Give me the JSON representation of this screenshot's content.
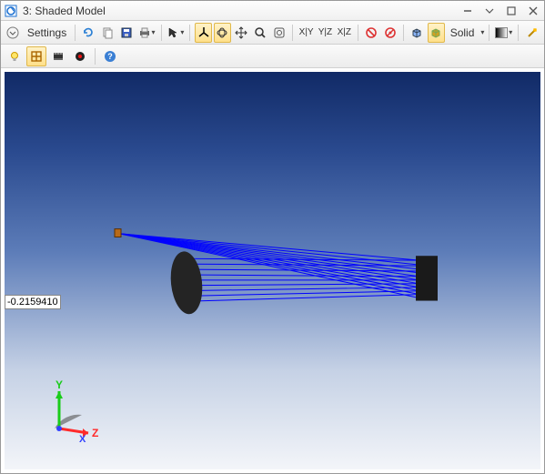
{
  "window": {
    "title": "3: Shaded Model",
    "icon_name": "app-icon"
  },
  "winctl": {
    "minimize": "▾",
    "restore": "❐",
    "close": "✕"
  },
  "toolbar1": {
    "settings_label": "Settings",
    "solid_label": "Solid",
    "axis_labels": {
      "xy": "X|Y",
      "yz": "Y|Z",
      "xz": "X|Z"
    }
  },
  "viewport": {
    "reading": "-0.2159410",
    "axis": {
      "x": "X",
      "y": "Y",
      "z": "Z"
    }
  },
  "colors": {
    "accent_blue": "#1a3fd1",
    "lens_dark": "#2a2a2a",
    "ray_blue": "#0000ff"
  }
}
